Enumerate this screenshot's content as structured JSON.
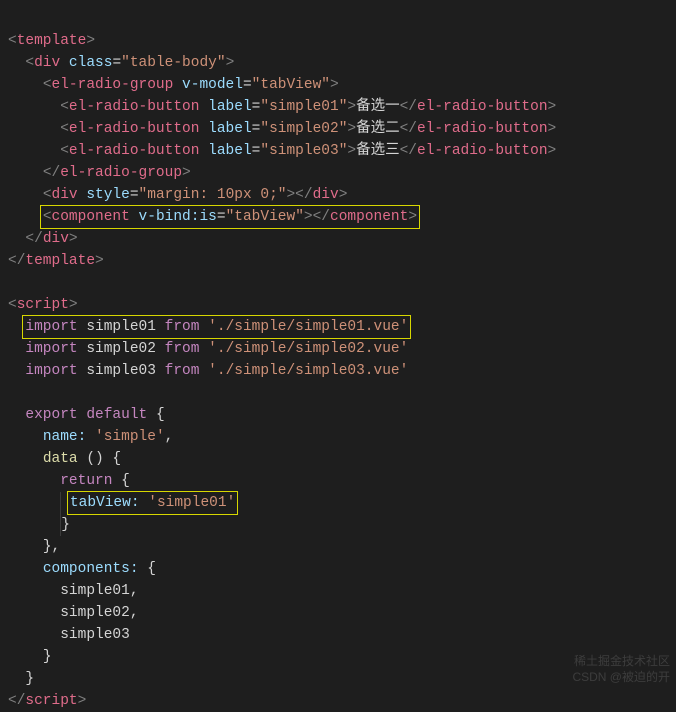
{
  "code": {
    "template": {
      "open": "template",
      "div": {
        "tag": "div",
        "classAttr": "class",
        "classVal": "table-body"
      },
      "group": {
        "tag": "el-radio-group",
        "vmodelAttr": "v-model",
        "vmodelVal": "tabView"
      },
      "radios": [
        {
          "tag": "el-radio-button",
          "labelAttr": "label",
          "labelVal": "simple01",
          "text": "备选一"
        },
        {
          "tag": "el-radio-button",
          "labelAttr": "label",
          "labelVal": "simple02",
          "text": "备选二"
        },
        {
          "tag": "el-radio-button",
          "labelAttr": "label",
          "labelVal": "simple03",
          "text": "备选三"
        }
      ],
      "spacer": {
        "tag": "div",
        "styleAttr": "style",
        "styleVal": "margin: 10px 0;"
      },
      "component": {
        "tag": "component",
        "bindAttr": "v-bind:is",
        "bindVal": "tabView"
      }
    },
    "script": {
      "tag": "script",
      "imports": [
        {
          "kwImport": "import",
          "name": "simple01",
          "kwFrom": "from",
          "path": "'./simple/simple01.vue'"
        },
        {
          "kwImport": "import",
          "name": "simple02",
          "kwFrom": "from",
          "path": "'./simple/simple02.vue'"
        },
        {
          "kwImport": "import",
          "name": "simple03",
          "kwFrom": "from",
          "path": "'./simple/simple03.vue'"
        }
      ],
      "export": {
        "kwExport": "export",
        "kwDefault": "default"
      },
      "nameProp": "name:",
      "nameVal": "'simple'",
      "dataFn": "data",
      "returnKw": "return",
      "tabViewProp": "tabView:",
      "tabViewVal": "'simple01'",
      "componentsProp": "components:",
      "componentsList": [
        "simple01,",
        "simple02,",
        "simple03"
      ]
    }
  },
  "watermark": {
    "line1": "稀土掘金技术社区",
    "line2": "CSDN @被迫的开"
  }
}
